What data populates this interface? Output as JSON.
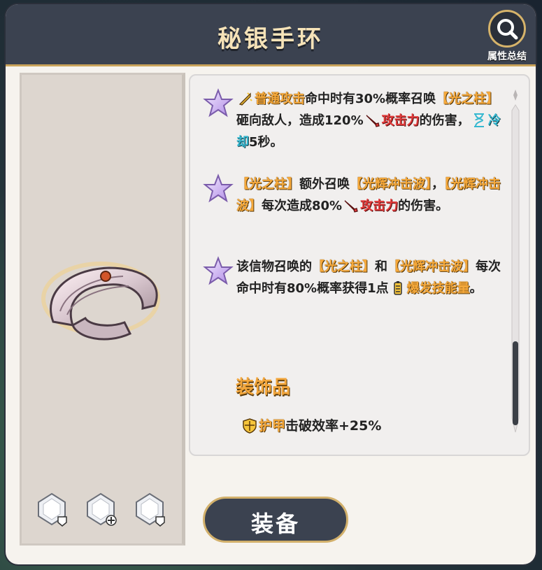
{
  "title": "秘银手环",
  "summary_button": {
    "label": "属性总结",
    "icon": "search-icon"
  },
  "effects": [
    {
      "icon": "star-icon",
      "parts": [
        {
          "t": "普通攻击",
          "c": "hl",
          "icon": "sword-icon"
        },
        {
          "t": "命中时有30%概率召唤",
          "c": ""
        },
        {
          "t": "【光之柱】",
          "c": "hl"
        },
        {
          "t": "砸向敌人，造成",
          "c": ""
        },
        {
          "t": "120%",
          "c": ""
        },
        {
          "t": "攻击力",
          "c": "atk",
          "icon": "attack-icon"
        },
        {
          "t": "的伤害，",
          "c": ""
        },
        {
          "t": "冷却",
          "c": "cd",
          "icon": "hourglass-icon"
        },
        {
          "t": "5秒。",
          "c": ""
        }
      ]
    },
    {
      "icon": "star-icon",
      "parts": [
        {
          "t": "【光之柱】",
          "c": "hl"
        },
        {
          "t": "额外召唤",
          "c": ""
        },
        {
          "t": "【光辉冲击波】",
          "c": "hl"
        },
        {
          "t": "，",
          "c": ""
        },
        {
          "t": "【光辉冲击波】",
          "c": "hl"
        },
        {
          "t": "每次造成80%",
          "c": ""
        },
        {
          "t": "攻击力",
          "c": "atk",
          "icon": "attack-icon"
        },
        {
          "t": "的伤害。",
          "c": ""
        }
      ]
    },
    {
      "icon": "star-icon",
      "parts": [
        {
          "t": "该信物召唤的",
          "c": ""
        },
        {
          "t": "【光之柱】",
          "c": "hl"
        },
        {
          "t": "和",
          "c": ""
        },
        {
          "t": "【光辉冲击波】",
          "c": "hl"
        },
        {
          "t": "每次命中时有80%概率获得1点",
          "c": ""
        },
        {
          "t": "爆发技能量",
          "c": "hl",
          "icon": "energy-icon"
        },
        {
          "t": "。",
          "c": ""
        }
      ]
    }
  ],
  "decoration": {
    "title": "装饰品",
    "stat_label": "护甲",
    "stat_text": "击破效率+25%",
    "icon": "shield-icon"
  },
  "gems": [
    {
      "icon": "gem-icon",
      "badge": "shield-badge-icon"
    },
    {
      "icon": "gem-icon",
      "badge": "plus-badge-icon"
    },
    {
      "icon": "gem-icon",
      "badge": "shield-badge-icon"
    }
  ],
  "equip_button": {
    "label": "装备"
  },
  "colors": {
    "accent": "#f6a93b",
    "attack": "#e23a3a",
    "cooldown": "#35b8d0",
    "header": "#3b4250",
    "gold_border": "#d2b06b"
  }
}
